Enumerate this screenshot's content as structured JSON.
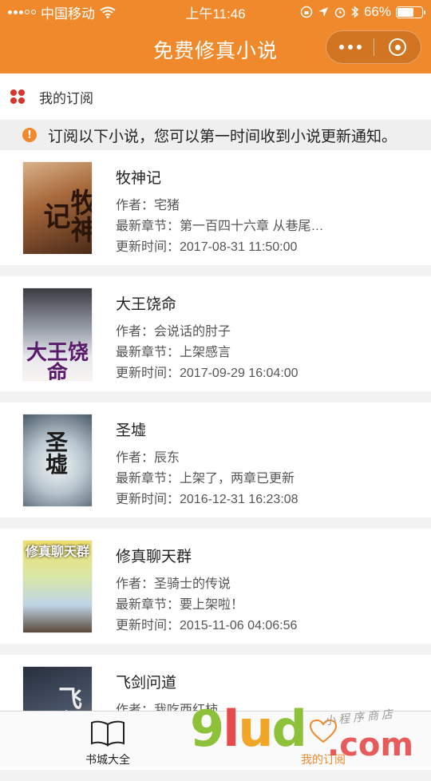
{
  "status_bar": {
    "carrier": "中国移动",
    "time": "上午11:46",
    "battery": "66%",
    "battery_level": 0.66
  },
  "navbar": {
    "title": "免费修真小说"
  },
  "section": {
    "label": "我的订阅"
  },
  "notice": {
    "text": "订阅以下小说，您可以第一时间收到小说更新通知。"
  },
  "books": [
    {
      "title": "牧神记",
      "cover_text": "牧神记",
      "author": "作者：宅猪",
      "latest": "最新章节：第一百四十六章 从巷尾…",
      "updated": "更新时间：2017-08-31 11:50:00"
    },
    {
      "title": "大王饶命",
      "cover_text": "大王饶命",
      "author": "作者：会说话的肘子",
      "latest": "最新章节：上架感言",
      "updated": "更新时间：2017-09-29 16:04:00"
    },
    {
      "title": "圣墟",
      "cover_text": "圣墟",
      "author": "作者：辰东",
      "latest": "最新章节：上架了，两章已更新",
      "updated": "更新时间：2016-12-31 16:23:08"
    },
    {
      "title": "修真聊天群",
      "cover_text": "修真聊天群",
      "author": "作者：圣骑士的传说",
      "latest": "最新章节：要上架啦！",
      "updated": "更新时间：2015-11-06 04:06:56"
    },
    {
      "title": "飞剑问道",
      "cover_text": "飞剑",
      "author": "作者：我吃西红柿",
      "latest": "",
      "updated": ""
    }
  ],
  "tabbar": {
    "tab1": "书城大全",
    "tab2": "我的订阅"
  },
  "watermark": {
    "big": "9lud",
    "com": ".com",
    "script": "小程序商店"
  }
}
